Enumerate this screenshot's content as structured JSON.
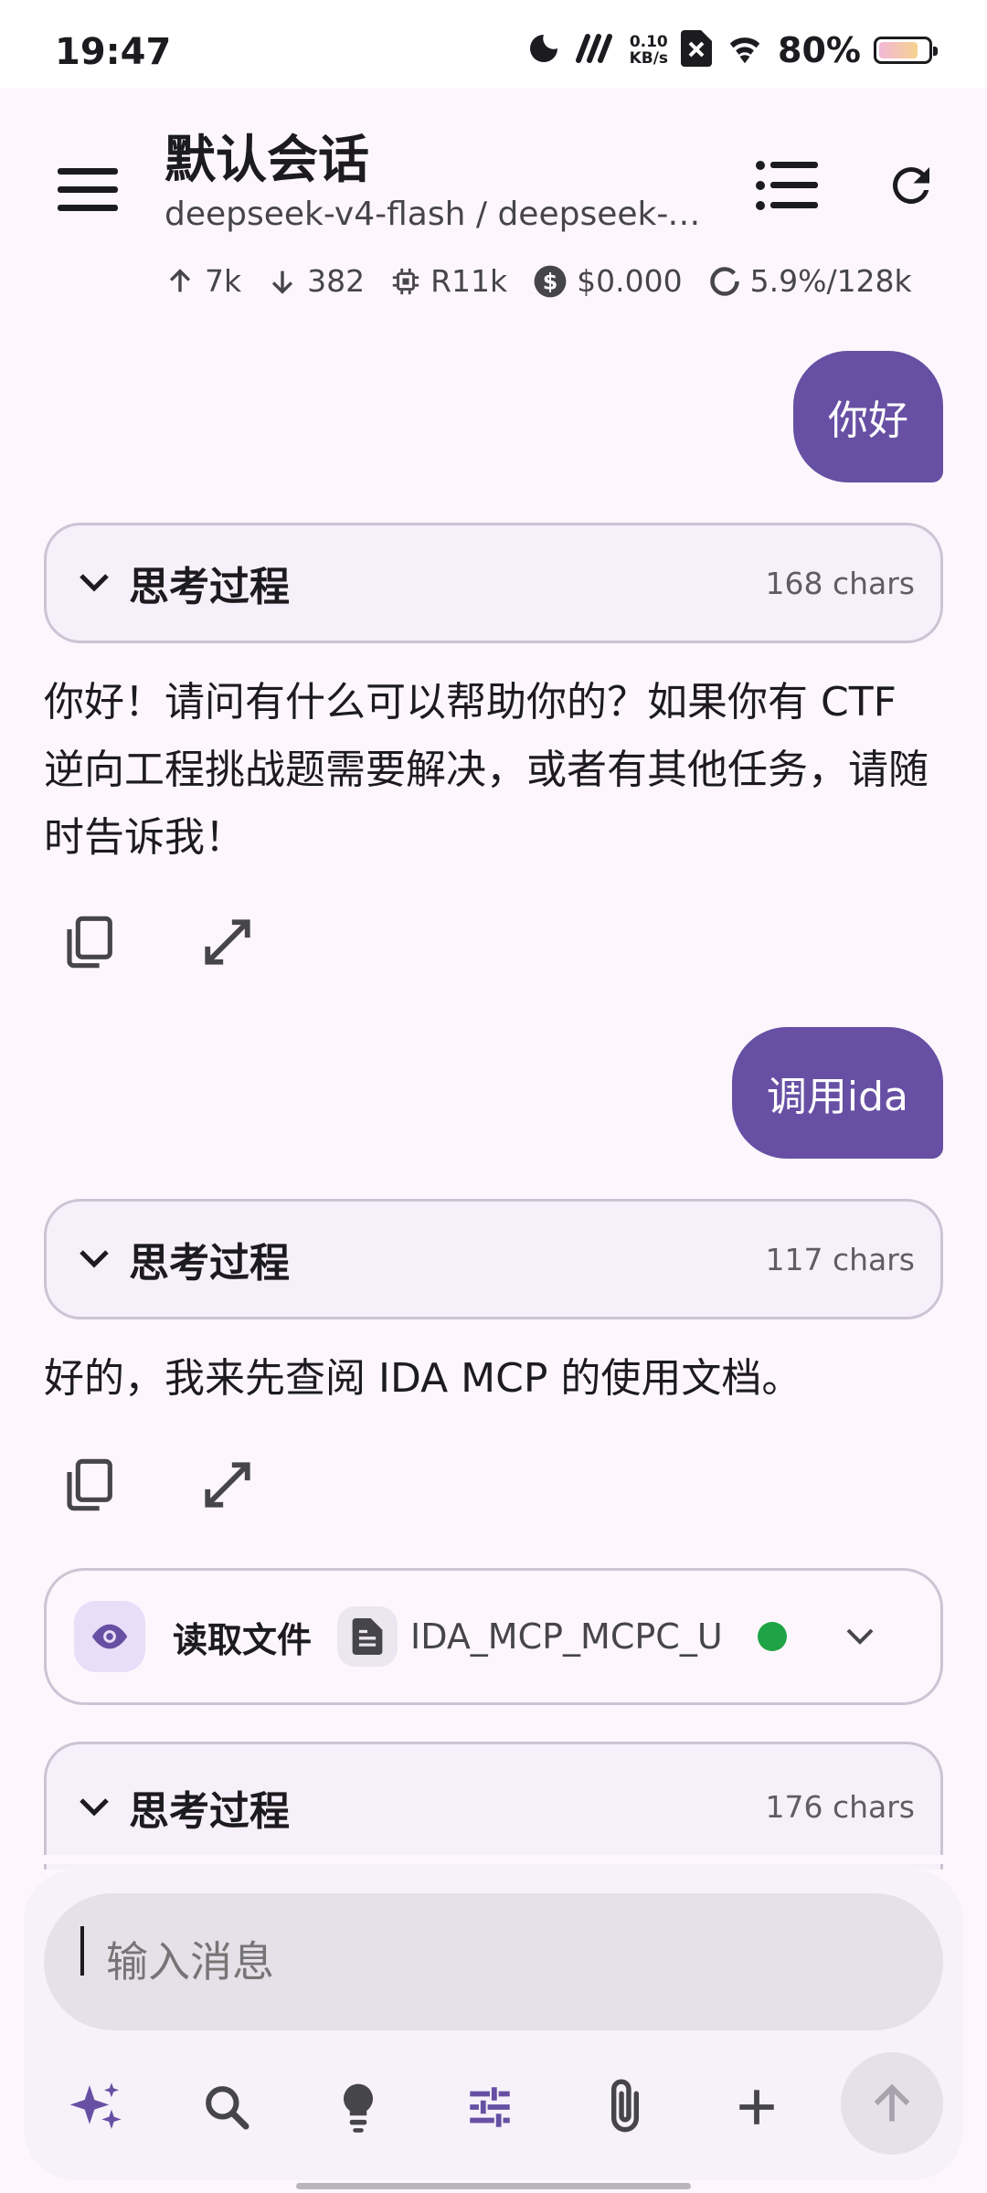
{
  "status_bar": {
    "time": "19:47",
    "net_speed_value": "0.10",
    "net_speed_unit": "KB/s",
    "battery": "80%",
    "battery_level": 0.8
  },
  "header": {
    "title": "默认会话",
    "subtitle": "deepseek-v4-flash / deepseek-v4-flash",
    "stats": {
      "upload": "7k",
      "download": "382",
      "cache": "R11k",
      "cost": "$0.000",
      "context": "5.9%/128k"
    }
  },
  "messages": [
    {
      "role": "user",
      "text": "你好"
    },
    {
      "role": "assistant",
      "thinking_label": "思考过程",
      "thinking_count": "168 chars",
      "text": "你好！请问有什么可以帮助你的？如果你有 CTF 逆向工程挑战题需要解决，或者有其他任务，请随时告诉我！"
    },
    {
      "role": "user",
      "text": "调用ida"
    },
    {
      "role": "assistant",
      "thinking_label": "思考过程",
      "thinking_count": "117 chars",
      "text": "好的，我来先查阅 IDA MCP 的使用文档。",
      "tool_call": {
        "label": "读取文件",
        "file": "IDA_MCP_MCPC_U",
        "status_color": "#1ea446"
      }
    },
    {
      "role": "assistant",
      "thinking_label": "思考过程",
      "thinking_count": "176 chars"
    }
  ],
  "composer": {
    "placeholder": "输入消息"
  },
  "colors": {
    "accent": "#6750a4",
    "background": "#fdf7fd",
    "card": "#f6f0fa"
  }
}
